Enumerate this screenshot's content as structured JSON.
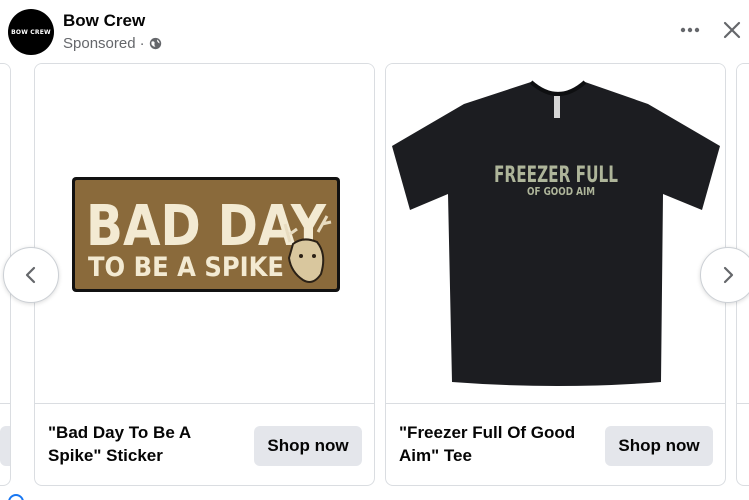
{
  "header": {
    "avatar_text": "BOW CREW",
    "page_name": "Bow Crew",
    "sponsored_label": "Sponsored",
    "separator": "·"
  },
  "icons": {
    "globe": "globe-icon",
    "more": "more-horizontal-icon",
    "close": "close-icon",
    "prev": "chevron-left-icon",
    "next": "chevron-right-icon"
  },
  "cards": [
    {
      "title": "\"Bad Day To Be A Spike\" Sticker",
      "cta": "Shop now",
      "sticker": {
        "line1": "BAD DAY",
        "line2": "TO BE A SPIKE"
      }
    },
    {
      "title": "\"Freezer Full Of Good Aim\" Tee",
      "cta": "Shop now",
      "shirt": {
        "line1": "FREEZER FULL",
        "line2": "OF GOOD AIM"
      }
    }
  ],
  "colors": {
    "sticker_bg": "#8a6a3b",
    "sticker_text": "#f3ead2",
    "shirt": "#1c1d21",
    "shirt_text": "#aeb59a",
    "button_bg": "#e4e6eb",
    "secondary_text": "#65676b"
  }
}
